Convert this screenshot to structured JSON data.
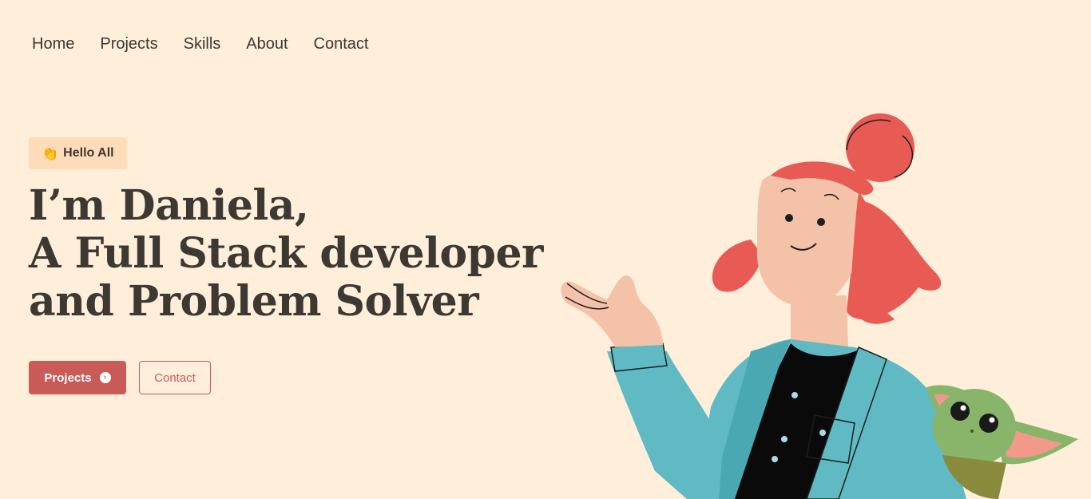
{
  "nav": {
    "items": [
      {
        "label": "Home"
      },
      {
        "label": "Projects"
      },
      {
        "label": "Skills"
      },
      {
        "label": "About"
      },
      {
        "label": "Contact"
      }
    ]
  },
  "hero": {
    "badge": {
      "icon": "clapping-hands-icon",
      "emoji": "👏",
      "label": "Hello All"
    },
    "headline": [
      "I’m Daniela,",
      "A Full Stack developer",
      "and Problem Solver"
    ],
    "buttons": {
      "primary": {
        "label": "Projects",
        "icon": "chevron-right-circle-icon"
      },
      "secondary": {
        "label": "Contact"
      }
    }
  },
  "colors": {
    "background": "#ffeed9",
    "badge_bg": "#ffdcb9",
    "accent": "#c85a57",
    "text": "#3c3832"
  }
}
